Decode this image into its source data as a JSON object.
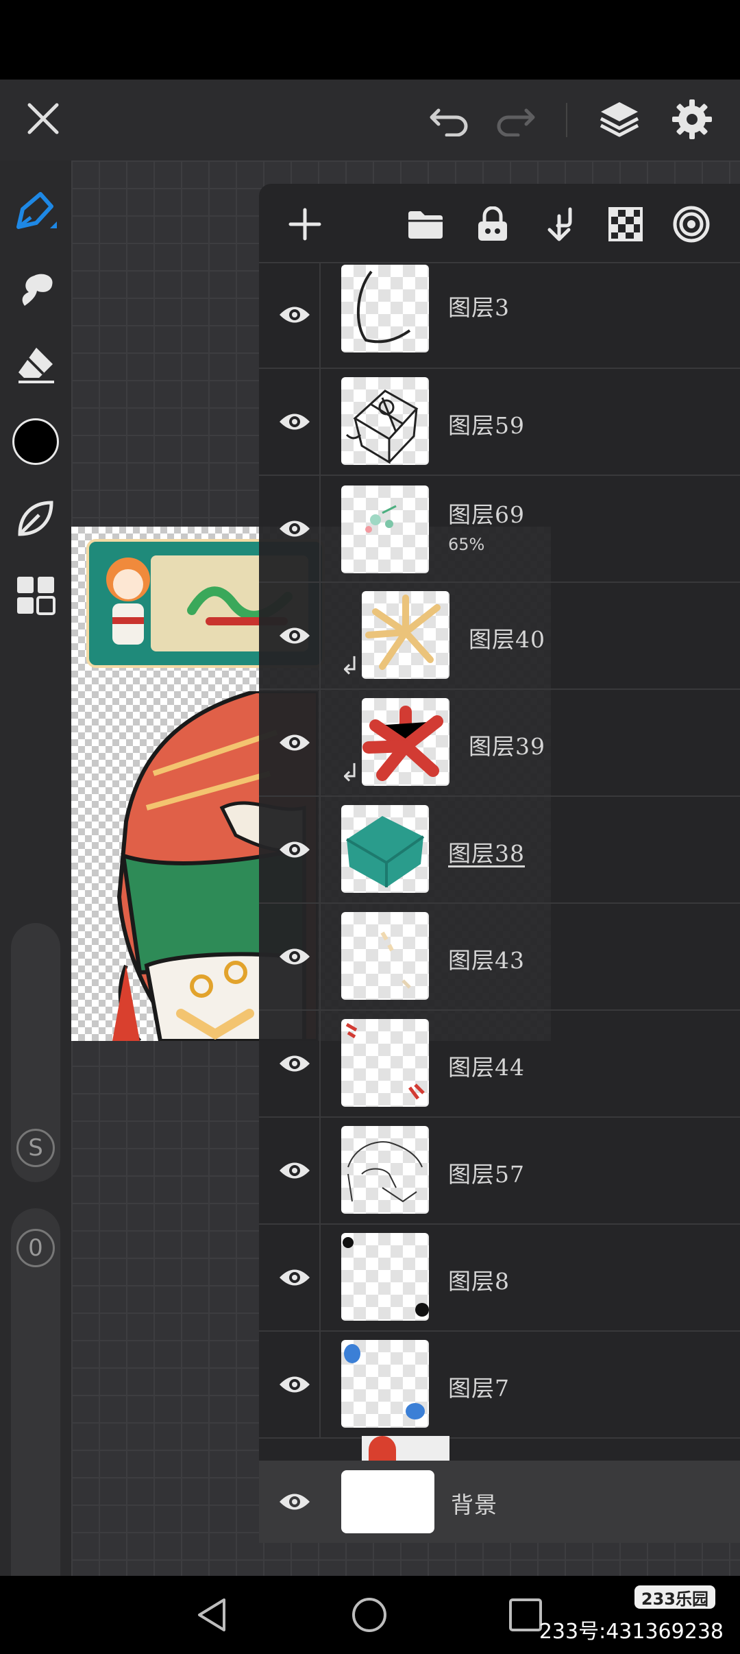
{
  "top_bar": {
    "close_icon": "close-icon",
    "undo_icon": "undo-icon",
    "redo_icon": "redo-icon",
    "layers_icon": "layers-icon",
    "settings_icon": "gear-icon"
  },
  "left_toolbar": {
    "tools": [
      "pen-icon",
      "smudge-icon",
      "eraser-icon",
      "color-swatch",
      "leaf-icon",
      "grid-icon"
    ],
    "current_color": "#000000",
    "accent_color": "#1e88e5",
    "size_label": "S",
    "opacity_label": "0"
  },
  "layers_panel": {
    "toolbar": [
      "add-layer-icon",
      "folder-icon",
      "lock-icon",
      "merge-down-icon",
      "transparency-icon",
      "layer-effects-icon"
    ],
    "layers": [
      {
        "name": "图层3",
        "opacity": "",
        "clipped": false,
        "active": false
      },
      {
        "name": "图层59",
        "opacity": "",
        "clipped": false,
        "active": false
      },
      {
        "name": "图层69",
        "opacity": "65%",
        "clipped": false,
        "active": false
      },
      {
        "name": "图层40",
        "opacity": "",
        "clipped": true,
        "active": false
      },
      {
        "name": "图层39",
        "opacity": "",
        "clipped": true,
        "active": false
      },
      {
        "name": "图层38",
        "opacity": "",
        "clipped": false,
        "active": true
      },
      {
        "name": "图层43",
        "opacity": "",
        "clipped": false,
        "active": false
      },
      {
        "name": "图层44",
        "opacity": "",
        "clipped": false,
        "active": false
      },
      {
        "name": "图层57",
        "opacity": "",
        "clipped": false,
        "active": false
      },
      {
        "name": "图层8",
        "opacity": "",
        "clipped": false,
        "active": false
      },
      {
        "name": "图层7",
        "opacity": "",
        "clipped": false,
        "active": false
      }
    ],
    "background_layer": {
      "name": "背景"
    }
  },
  "watermark": {
    "logo": "233乐园",
    "text": "233号:431369238"
  }
}
